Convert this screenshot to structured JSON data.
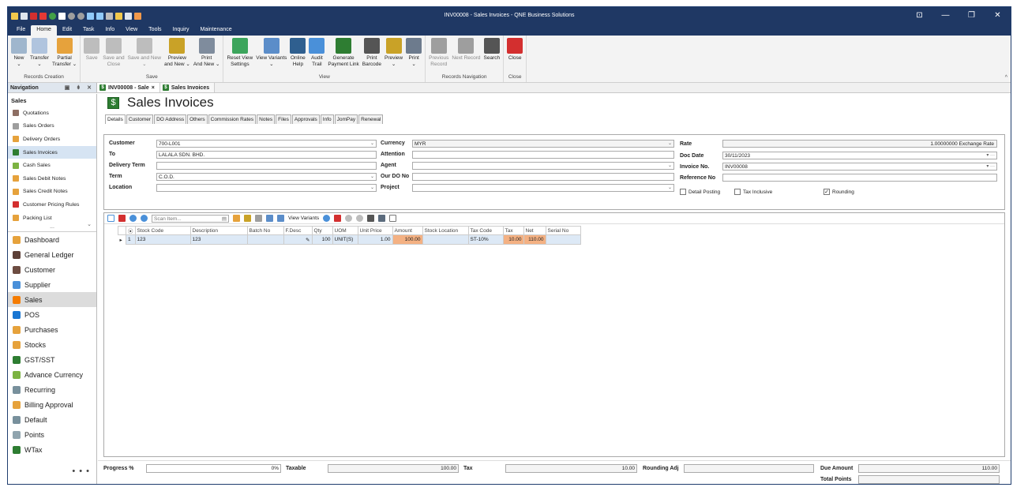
{
  "window": {
    "title": "INV00008 - Sales Invoices - QNE Business Solutions",
    "min": "—",
    "restore": "❐",
    "close": "✕"
  },
  "menu_tabs": [
    "File",
    "Home",
    "Edit",
    "Task",
    "Info",
    "View",
    "Tools",
    "Inquiry",
    "Maintenance"
  ],
  "ribbon": {
    "groups": [
      {
        "label": "Records Creation",
        "buttons": [
          {
            "label": "New\n⌄",
            "icon": "new-doc-icon",
            "color": "#9fb6cd"
          },
          {
            "label": "Transfer\n⌄",
            "icon": "transfer-icon",
            "color": "#b0c4de"
          },
          {
            "label": "Partial\nTransfer ⌄",
            "icon": "partial-transfer-icon",
            "color": "#e6a23c"
          }
        ]
      },
      {
        "label": "Save",
        "buttons": [
          {
            "label": "Save",
            "icon": "save-icon",
            "color": "#bdbdbd",
            "disabled": true
          },
          {
            "label": "Save and\nClose",
            "icon": "save-close-icon",
            "color": "#bdbdbd",
            "disabled": true
          },
          {
            "label": "Save and New\n⌄",
            "icon": "save-new-icon",
            "color": "#bdbdbd",
            "disabled": true
          },
          {
            "label": "Preview\nand New ⌄",
            "icon": "preview-new-icon",
            "color": "#c9a227"
          },
          {
            "label": "Print\nAnd New ⌄",
            "icon": "print-new-icon",
            "color": "#7f8c9d"
          }
        ]
      },
      {
        "label": "View",
        "buttons": [
          {
            "label": "Reset View\nSettings",
            "icon": "reset-view-icon",
            "color": "#3ca55c"
          },
          {
            "label": "View Variants\n⌄",
            "icon": "view-variants-icon",
            "color": "#5b8dc9"
          },
          {
            "label": "Online\nHelp",
            "icon": "online-help-icon",
            "color": "#2f5f8f"
          },
          {
            "label": "Audit\nTrail",
            "icon": "audit-trail-icon",
            "color": "#4a90d9"
          },
          {
            "label": "Generate\nPayment Link",
            "icon": "payment-link-icon",
            "color": "#2e7d32"
          },
          {
            "label": "Print\nBarcode",
            "icon": "barcode-icon",
            "color": "#555555"
          },
          {
            "label": "Preview\n⌄",
            "icon": "preview-icon",
            "color": "#c9a227"
          },
          {
            "label": "Print\n⌄",
            "icon": "print-icon",
            "color": "#6d7b8d"
          }
        ]
      },
      {
        "label": "Records Navigation",
        "buttons": [
          {
            "label": "Previous\nRecord",
            "icon": "previous-record-icon",
            "color": "#9e9e9e",
            "disabled": true
          },
          {
            "label": "Next Record",
            "icon": "next-record-icon",
            "color": "#9e9e9e",
            "disabled": true
          },
          {
            "label": "Search",
            "icon": "search-binoculars-icon",
            "color": "#555555"
          }
        ]
      },
      {
        "label": "Close",
        "buttons": [
          {
            "label": "Close",
            "icon": "close-red-icon",
            "color": "#d32f2f"
          }
        ]
      }
    ],
    "collapse": "^"
  },
  "navigation": {
    "header": "Navigation",
    "section": "Sales",
    "items": [
      {
        "label": "Quotations",
        "color": "#8d6e63"
      },
      {
        "label": "Sales Orders",
        "color": "#9e9e9e"
      },
      {
        "label": "Delivery Orders",
        "color": "#e6a23c"
      },
      {
        "label": "Sales Invoices",
        "color": "#2e7d32",
        "selected": true
      },
      {
        "label": "Cash Sales",
        "color": "#7cb342"
      },
      {
        "label": "Sales Debit Notes",
        "color": "#e6a23c"
      },
      {
        "label": "Sales Credit Notes",
        "color": "#e6a23c"
      },
      {
        "label": "Customer Pricing Rules",
        "color": "#d32f2f"
      },
      {
        "label": "Packing List",
        "color": "#e6a23c"
      }
    ],
    "more": "...",
    "modules": [
      {
        "label": "Dashboard",
        "color": "#e6a23c"
      },
      {
        "label": "General Ledger",
        "color": "#5d4037"
      },
      {
        "label": "Customer",
        "color": "#6d4c41"
      },
      {
        "label": "Supplier",
        "color": "#4a90d9"
      },
      {
        "label": "Sales",
        "color": "#f57c00",
        "selected": true
      },
      {
        "label": "POS",
        "color": "#1976d2"
      },
      {
        "label": "Purchases",
        "color": "#e6a23c"
      },
      {
        "label": "Stocks",
        "color": "#e6a23c"
      },
      {
        "label": "GST/SST",
        "color": "#2e7d32"
      },
      {
        "label": "Advance Currency",
        "color": "#7cb342"
      },
      {
        "label": "Recurring",
        "color": "#78909c"
      },
      {
        "label": "Billing Approval",
        "color": "#e6a23c"
      },
      {
        "label": "Default",
        "color": "#78909c"
      },
      {
        "label": "Points",
        "color": "#90a4ae"
      },
      {
        "label": "WTax",
        "color": "#2e7d32"
      }
    ],
    "dots": "• • •"
  },
  "doc_tabs": [
    {
      "label": "INV00008 - Sale",
      "close": "×"
    },
    {
      "label": "Sales Invoices"
    }
  ],
  "form": {
    "title": "Sales Invoices",
    "tabs": [
      "Details",
      "Customer",
      "DO Address",
      "Others",
      "Commission Rates",
      "Notes",
      "Files",
      "Approvals",
      "Info",
      "JomPay",
      "Renewal"
    ],
    "labels": {
      "customer": "Customer",
      "to": "To",
      "delivery_term": "Delivery Term",
      "term": "Term",
      "location": "Location",
      "currency": "Currency",
      "attention": "Attention",
      "agent": "Agent",
      "our_do_no": "Our DO No",
      "project": "Project",
      "rate": "Rate",
      "doc_date": "Doc Date",
      "invoice_no": "Invoice No.",
      "reference_no": "Reference No"
    },
    "values": {
      "customer": "700-L001",
      "to": "LALALA SDN. BHD.",
      "delivery_term": "",
      "term": "C.O.D.",
      "location": "",
      "currency": "MYR",
      "attention": "",
      "agent": "",
      "our_do_no": "",
      "project": "",
      "rate": "1.00000000",
      "rate_suffix": "Exchange Rate",
      "doc_date": "30/11/2023",
      "invoice_no": "INV00008",
      "reference_no": ""
    },
    "checks": {
      "detail_posting": {
        "label": "Detail Posting",
        "checked": false
      },
      "tax_inclusive": {
        "label": "Tax Inclusive",
        "checked": false
      },
      "rounding": {
        "label": "Rounding",
        "checked": true
      }
    }
  },
  "grid": {
    "scan_placeholder": "Scan Item...",
    "view_variants": "View Variants",
    "columns": [
      "Stock Code",
      "Description",
      "Batch No",
      "F.Desc",
      "Qty",
      "UOM",
      "Unit Price",
      "Amount",
      "Stock Location",
      "Tax Code",
      "Tax",
      "Net",
      "Serial No"
    ],
    "rows": [
      {
        "no": "1",
        "stock_code": "123",
        "description": "123",
        "batch_no": "",
        "f_desc": "",
        "qty": "100",
        "uom": "UNIT(S)",
        "unit_price": "1.00",
        "amount": "100.00",
        "stock_location": "",
        "tax_code": "ST-10%",
        "tax": "10.00",
        "net": "110.00",
        "serial_no": ""
      }
    ]
  },
  "footer": {
    "progress_label": "Progress %",
    "progress_value": "0%",
    "progress": 0,
    "taxable_label": "Taxable",
    "taxable_value": "100.00",
    "tax_label": "Tax",
    "tax_value": "10.00",
    "rounding_label": "Rounding Adj",
    "rounding_value": "",
    "due_label": "Due Amount",
    "due_value": "110.00",
    "points_label": "Total Points",
    "points_value": ""
  }
}
